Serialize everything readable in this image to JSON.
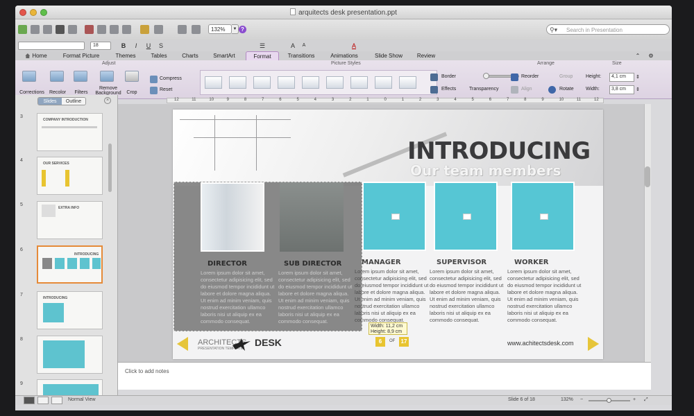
{
  "window": {
    "title": "arquitects desk presentation.ppt"
  },
  "toolbar": {
    "zoom": "132%",
    "search_placeholder": "Search in Presentation",
    "help": "?"
  },
  "format_bar": {
    "font_size": "18",
    "bold": "B",
    "italic": "I",
    "underline": "U",
    "strike": "S",
    "grow": "A",
    "shrink": "A",
    "font_color": "A"
  },
  "tabs": [
    "Home",
    "Format Picture",
    "Themes",
    "Tables",
    "Charts",
    "SmartArt",
    "Format",
    "Transitions",
    "Animations",
    "Slide Show",
    "Review"
  ],
  "ribbon": {
    "groups": {
      "adjust": "Adjust",
      "picture_styles": "Picture Styles",
      "arrange": "Arrange",
      "size": "Size"
    },
    "buttons": {
      "corrections": "Corrections",
      "recolor": "Recolor",
      "filters": "Filters",
      "remove_background_1": "Remove",
      "remove_background_2": "Background",
      "crop": "Crop",
      "compress": "Compress",
      "reset": "Reset",
      "border": "Border",
      "effects": "Effects",
      "transparency": "Transparency",
      "reorder": "Reorder",
      "group": "Group",
      "align": "Align",
      "rotate": "Rotate",
      "height_label": "Height:",
      "width_label": "Width:"
    },
    "height_value": "4,1 cm",
    "width_value": "3,8 cm"
  },
  "ruler": [
    "12",
    "11",
    "10",
    "9",
    "8",
    "7",
    "6",
    "5",
    "4",
    "3",
    "2",
    "1",
    "0",
    "1",
    "2",
    "3",
    "4",
    "5",
    "6",
    "7",
    "8",
    "9",
    "10",
    "11",
    "12"
  ],
  "panel": {
    "tab_slides": "Slides",
    "tab_outline": "Outline",
    "thumbs": [
      {
        "num": "3",
        "title": "COMPANY INTRODUCTION"
      },
      {
        "num": "4",
        "title": "OUR SERVICES"
      },
      {
        "num": "5",
        "title": "EXTRA INFO"
      },
      {
        "num": "6",
        "title": "INTRODUCING"
      },
      {
        "num": "7",
        "title": "INTRODUCING"
      },
      {
        "num": "8",
        "title": ""
      },
      {
        "num": "9",
        "title": ""
      }
    ]
  },
  "slide": {
    "title": "INTRODUCING",
    "subtitle": "Our team members",
    "members": [
      {
        "role": "DIRECTOR",
        "desc": "Lorem ipsum dolor sit amet, consectetur adipisicing elit, sed do eiusmod tempor incididunt ut labore et dolore magna aliqua. Ut enim ad minim veniam, quis nostrud exercitation ullamco laboris nisi ut aliquip ex ea commodo consequat."
      },
      {
        "role": "SUB DIRECTOR",
        "desc": "Lorem ipsum dolor sit amet, consectetur adipisicing elit, sed do eiusmod tempor incididunt ut labore et dolore magna aliqua. Ut enim ad minim veniam, quis nostrud exercitation ullamco laboris nisi ut aliquip ex ea commodo consequat."
      },
      {
        "role": "MANAGER",
        "desc": "Lorem ipsum dolor sit amet, consectetur adipisicing elit, sed do eiusmod tempor incididunt ut labore et dolore magna aliqua. Ut enim ad minim veniam, quis nostrud exercitation ullamco laboris nisi ut aliquip ex ea commodo consequat."
      },
      {
        "role": "SUPERVISOR",
        "desc": "Lorem ipsum dolor sit amet, consectetur adipisicing elit, sed do eiusmod tempor incididunt ut labore et dolore magna aliqua. Ut enim ad minim veniam, quis nostrud exercitation ullamco laboris nisi ut aliquip ex ea commodo consequat."
      },
      {
        "role": "WORKER",
        "desc": "Lorem ipsum dolor sit amet, consectetur adipisicing elit, sed do eiusmod tempor incididunt ut labore et dolore magna aliqua. Ut enim ad minim veniam, quis nostrud exercitation ullamco laboris nisi ut aliquip ex ea commodo consequat."
      }
    ],
    "dimension_tooltip": {
      "width": "Width: 11,2 cm",
      "height": "Height: 8,9 cm"
    },
    "footer": {
      "logo_text": "ARCHITECTS",
      "logo_sub": "PRESENTATION TEMPLATE",
      "logo_desk": "DESK",
      "page_current": "6",
      "page_of": "OF",
      "page_total": "17",
      "website": "www.achitectsdesk.com"
    }
  },
  "notes": {
    "placeholder": "Click to add notes"
  },
  "status": {
    "view": "Normal View",
    "slide_info": "Slide 6 of 18",
    "zoom": "132%"
  },
  "colors": {
    "accent_cyan": "#56c6d4",
    "accent_yellow": "#e8c430",
    "ribbon_lavender": "#e8d8ef",
    "thumb_selected": "#e58a38"
  }
}
